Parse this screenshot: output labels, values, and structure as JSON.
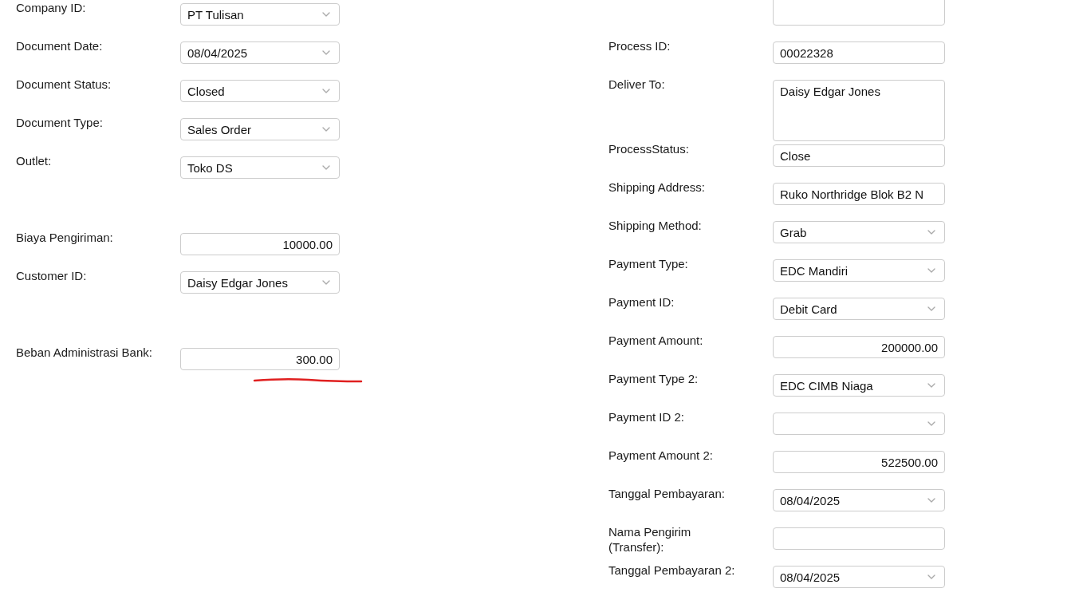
{
  "left_fields": [
    {
      "kind": "select",
      "label": "Company ID:",
      "value": "PT Tulisan"
    },
    {
      "kind": "select",
      "label": "Document Date:",
      "value": "08/04/2025"
    },
    {
      "kind": "select",
      "label": "Document Status:",
      "value": "Closed"
    },
    {
      "kind": "select",
      "label": "Document Type:",
      "value": "Sales Order"
    },
    {
      "kind": "select",
      "label": "Outlet:",
      "value": "Toko DS"
    },
    {
      "kind": "spacer"
    },
    {
      "kind": "number",
      "label": "Biaya Pengiriman:",
      "value": "10000.00"
    },
    {
      "kind": "select",
      "label": "Customer ID:",
      "value": "Daisy Edgar Jones"
    },
    {
      "kind": "spacer"
    },
    {
      "kind": "number",
      "label": "Beban Administrasi Bank:",
      "value": "300.00",
      "underlined": true
    }
  ],
  "right_fields": [
    {
      "kind": "clipped"
    },
    {
      "kind": "text",
      "label": "Process ID:",
      "value": "00022328"
    },
    {
      "kind": "textarea",
      "label": "Deliver To:",
      "value": "Daisy Edgar Jones"
    },
    {
      "kind": "text",
      "label": "ProcessStatus:",
      "value": "Close"
    },
    {
      "kind": "text",
      "label": "Shipping Address:",
      "value": "Ruko Northridge Blok B2 N"
    },
    {
      "kind": "select",
      "label": "Shipping Method:",
      "value": "Grab"
    },
    {
      "kind": "select",
      "label": "Payment Type:",
      "value": "EDC Mandiri"
    },
    {
      "kind": "select",
      "label": "Payment ID:",
      "value": "Debit Card"
    },
    {
      "kind": "number",
      "label": "Payment Amount:",
      "value": "200000.00"
    },
    {
      "kind": "select",
      "label": "Payment Type 2:",
      "value": "EDC CIMB Niaga"
    },
    {
      "kind": "select",
      "label": "Payment ID 2:"
    },
    {
      "kind": "number",
      "label": "Payment Amount 2:",
      "value": "522500.00"
    },
    {
      "kind": "select",
      "label": "Tanggal Pembayaran:",
      "value": "08/04/2025"
    },
    {
      "kind": "text",
      "label": "Nama Pengirim (Transfer):"
    },
    {
      "kind": "select",
      "label": "Tanggal Pembayaran 2:",
      "value": "08/04/2025"
    }
  ]
}
